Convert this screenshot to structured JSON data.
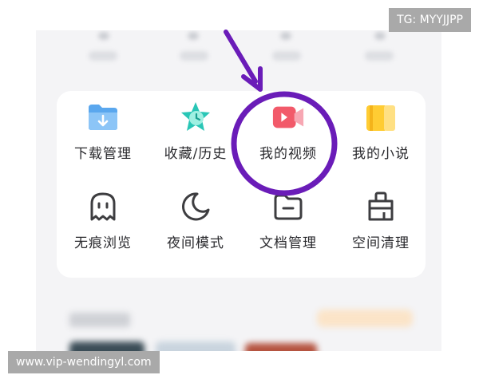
{
  "watermarks": {
    "top_right": "TG: MYYJJPP",
    "bottom_left": "www.vip-wendingyl.com"
  },
  "menu": {
    "row1": [
      {
        "label": "下载管理",
        "icon": "download-folder-icon"
      },
      {
        "label": "收藏/历史",
        "icon": "star-clock-icon"
      },
      {
        "label": "我的视频",
        "icon": "video-camera-icon"
      },
      {
        "label": "我的小说",
        "icon": "book-icon"
      }
    ],
    "row2": [
      {
        "label": "无痕浏览",
        "icon": "ghost-icon"
      },
      {
        "label": "夜间模式",
        "icon": "moon-icon"
      },
      {
        "label": "文档管理",
        "icon": "folder-icon"
      },
      {
        "label": "空间清理",
        "icon": "broom-icon"
      }
    ]
  },
  "annotation": {
    "highlighted_item": "我的视频",
    "color": "#6a1cb8"
  },
  "colors": {
    "download_blue": "#5aa7ee",
    "favorites_teal": "#29c6b6",
    "video_red": "#f25a6a",
    "novel_yellow": "#ffcc33",
    "outline_gray": "#3d3d40"
  }
}
